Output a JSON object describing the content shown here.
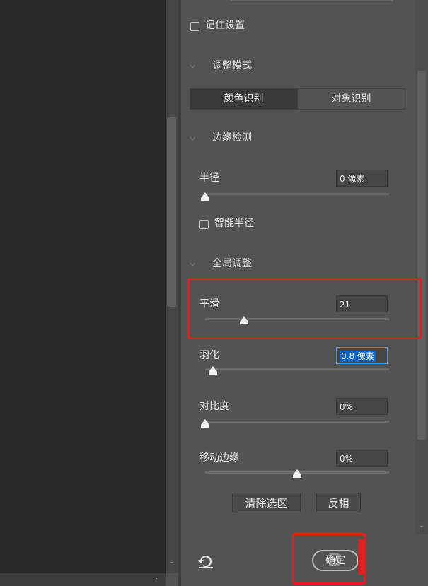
{
  "remember_settings": {
    "label": "记住设置",
    "checked": false
  },
  "adjust_mode": {
    "section_label": "调整模式",
    "segments": [
      {
        "label": "颜色识别",
        "active": true
      },
      {
        "label": "对象识别",
        "active": false
      }
    ]
  },
  "edge_detection": {
    "section_label": "边缘检测",
    "radius": {
      "label": "半径",
      "value": "0 像素",
      "slider_fraction": 0.0
    },
    "smart_radius": {
      "label": "智能半径",
      "checked": false
    }
  },
  "global_refine": {
    "section_label": "全局调整",
    "smooth": {
      "label": "平滑",
      "value": "21",
      "slider_fraction": 0.21
    },
    "feather": {
      "label": "羽化",
      "value": "0.8",
      "unit": "像素",
      "slider_fraction": 0.04
    },
    "contrast": {
      "label": "对比度",
      "value": "0%",
      "slider_fraction": 0.0
    },
    "shift_edge": {
      "label": "移动边缘",
      "value": "0%",
      "slider_fraction": 0.5
    }
  },
  "buttons": {
    "clear_selection": "清除选区",
    "invert": "反相",
    "ok": "确定"
  },
  "icons": {
    "chevron": "chevron-down-icon",
    "reset": "reset-icon",
    "scroll_down": "scroll-down-arrow-icon",
    "scroll_right": "scroll-right-arrow-icon"
  },
  "colors": {
    "panel_bg": "#535353",
    "canvas_bg": "#282828",
    "highlight_red": "#e02020",
    "selection_blue": "#0d63c6"
  }
}
